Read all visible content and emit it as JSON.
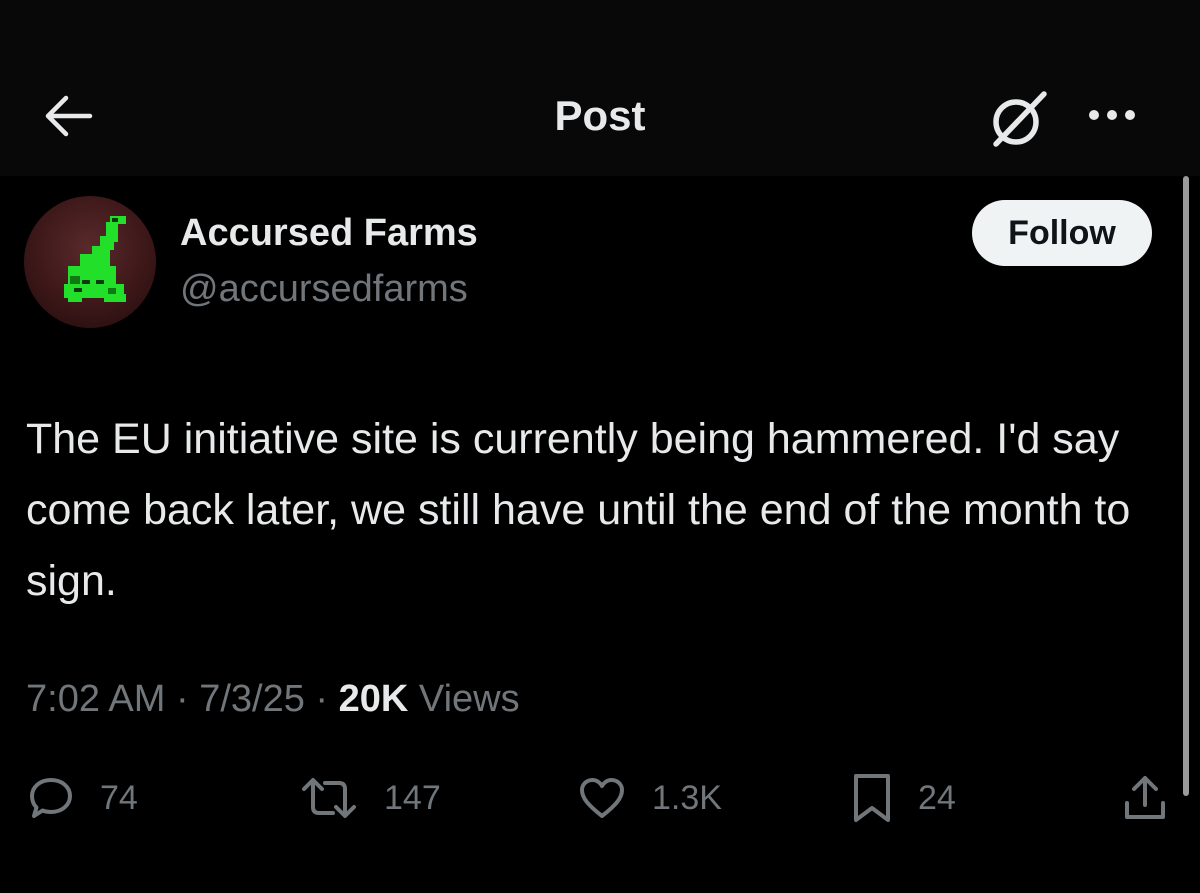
{
  "header": {
    "title": "Post",
    "back_icon": "arrow-left-icon",
    "grok_icon": "grok-icon",
    "more_icon": "more-dots-icon"
  },
  "author": {
    "display_name": "Accursed Farms",
    "handle": "@accursedfarms",
    "follow_label": "Follow",
    "avatar_icon": "green-pixel-creature-avatar"
  },
  "post": {
    "text": "The EU initiative site is currently being hammered. I'd say come back later, we still have until the end of the month to sign.",
    "time": "7:02 AM",
    "date": "7/3/25",
    "views_count": "20K",
    "views_label": "Views"
  },
  "actions": {
    "replies": "74",
    "reposts": "147",
    "likes": "1.3K",
    "bookmarks": "24"
  },
  "colors": {
    "background": "#000000",
    "header_background": "#080808",
    "primary_text": "#e7e9ea",
    "secondary_text": "#71767b",
    "follow_button_bg": "#eff3f4",
    "avatar_creature": "#22e02a"
  }
}
